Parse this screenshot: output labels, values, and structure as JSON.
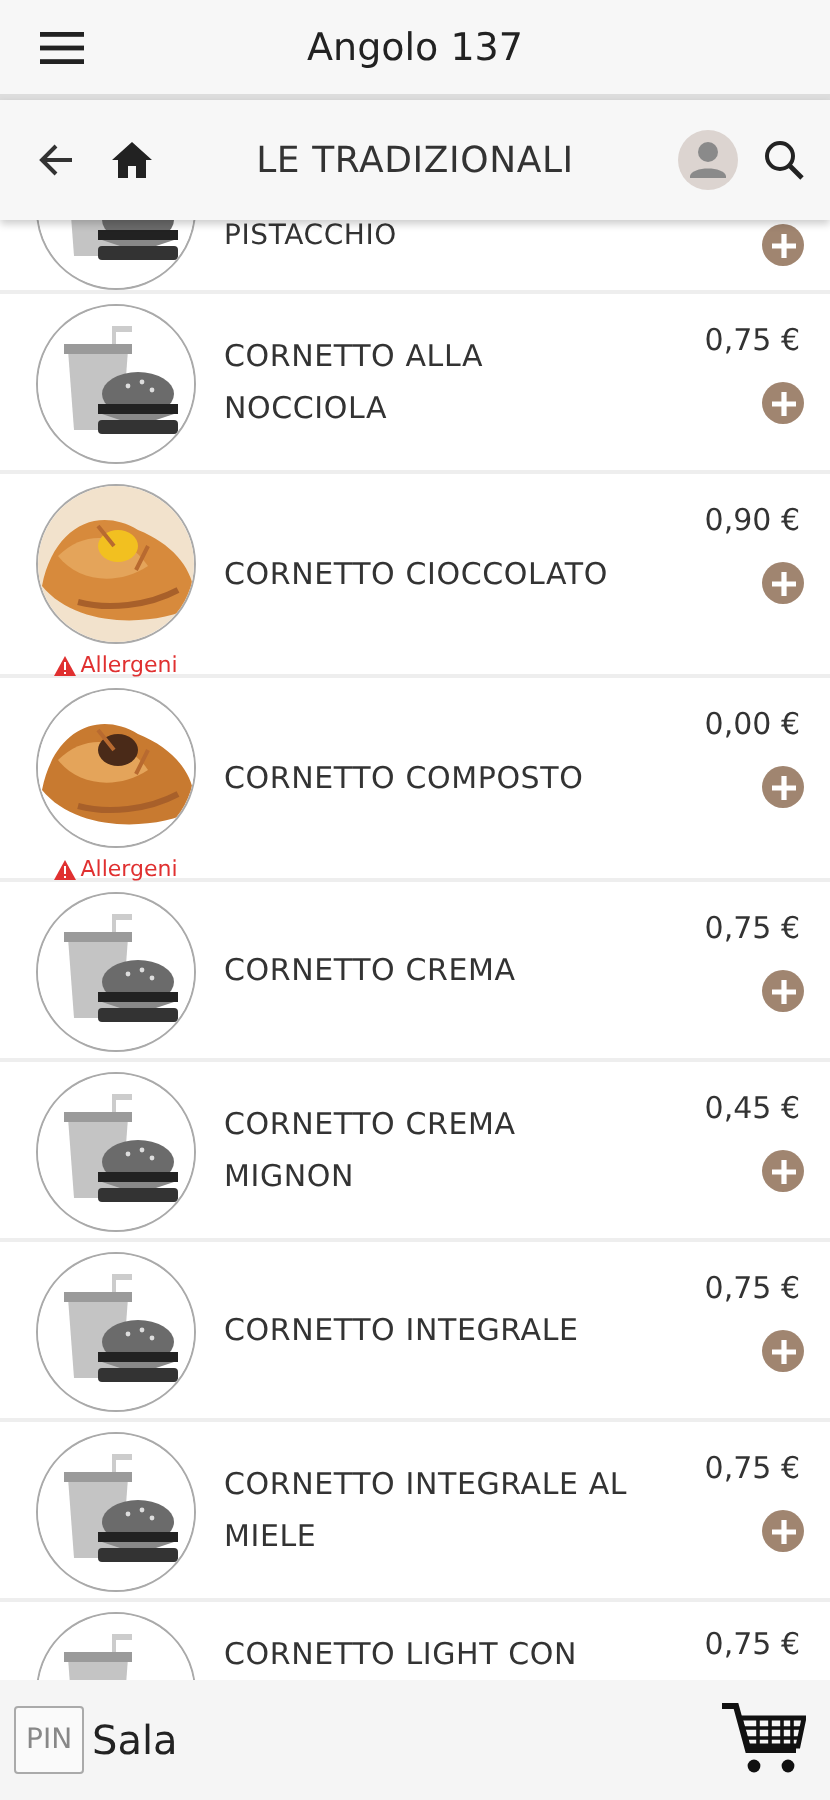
{
  "header": {
    "title": "Angolo 137"
  },
  "subheader": {
    "title": "LE TRADIZIONALI"
  },
  "previous_item": {
    "name": "PISTACCHIO"
  },
  "products": [
    {
      "name": "CORNETTO ALLA NOCCIOLA",
      "price": "0,75 €",
      "kind": "placeholder",
      "allergens": false
    },
    {
      "name": "CORNETTO CIOCCOLATO",
      "price": "0,90 €",
      "allergens": true,
      "allergen_label": "Allergeni"
    },
    {
      "name": "CORNETTO COMPOSTO",
      "price": "0,00 €",
      "allergens": true,
      "allergen_label": "Allergeni"
    },
    {
      "name": "CORNETTO CREMA",
      "price": "0,75 €",
      "kind": "placeholder",
      "allergens": false
    },
    {
      "name": "CORNETTO CREMA MIGNON",
      "price": "0,45 €",
      "kind": "placeholder",
      "allergens": false
    },
    {
      "name": "CORNETTO INTEGRALE",
      "price": "0,75 €",
      "kind": "placeholder",
      "allergens": false
    },
    {
      "name": "CORNETTO INTEGRALE AL MIELE",
      "price": "0,75 €",
      "kind": "placeholder",
      "allergens": false
    },
    {
      "name": "CORNETTO LIGHT CON",
      "price": "0,75 €",
      "kind": "placeholder",
      "allergens": false
    }
  ],
  "footer": {
    "pin": "PIN",
    "room": "Sala"
  }
}
